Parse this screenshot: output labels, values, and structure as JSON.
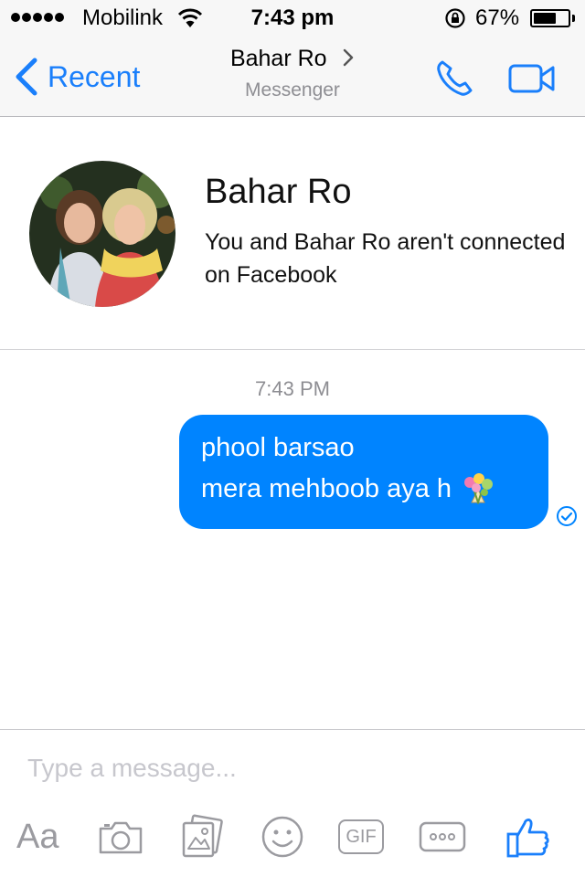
{
  "status_bar": {
    "carrier": "Mobilink",
    "time": "7:43 pm",
    "battery_percent_label": "67%",
    "battery_level": 0.67
  },
  "nav": {
    "back_label": "Recent",
    "title": "Bahar Ro",
    "subtitle": "Messenger",
    "accent_color": "#1a7ffb"
  },
  "profile": {
    "name": "Bahar Ro",
    "note": "You and Bahar Ro aren't connected on Facebook"
  },
  "thread": {
    "timestamp": "7:43 PM",
    "messages": [
      {
        "sender": "me",
        "lines": [
          "phool barsao",
          "mera mehboob aya h"
        ],
        "emoji": "bouquet-icon",
        "status": "delivered-check-icon",
        "bubble_color": "#0084ff"
      }
    ]
  },
  "composer": {
    "placeholder": "Type a message...",
    "value": "",
    "text_button": "Aa",
    "gif_button": "GIF",
    "tools": [
      "text-format-icon",
      "camera-icon",
      "gallery-icon",
      "emoji-icon",
      "gif-icon",
      "more-icon",
      "like-icon"
    ]
  }
}
